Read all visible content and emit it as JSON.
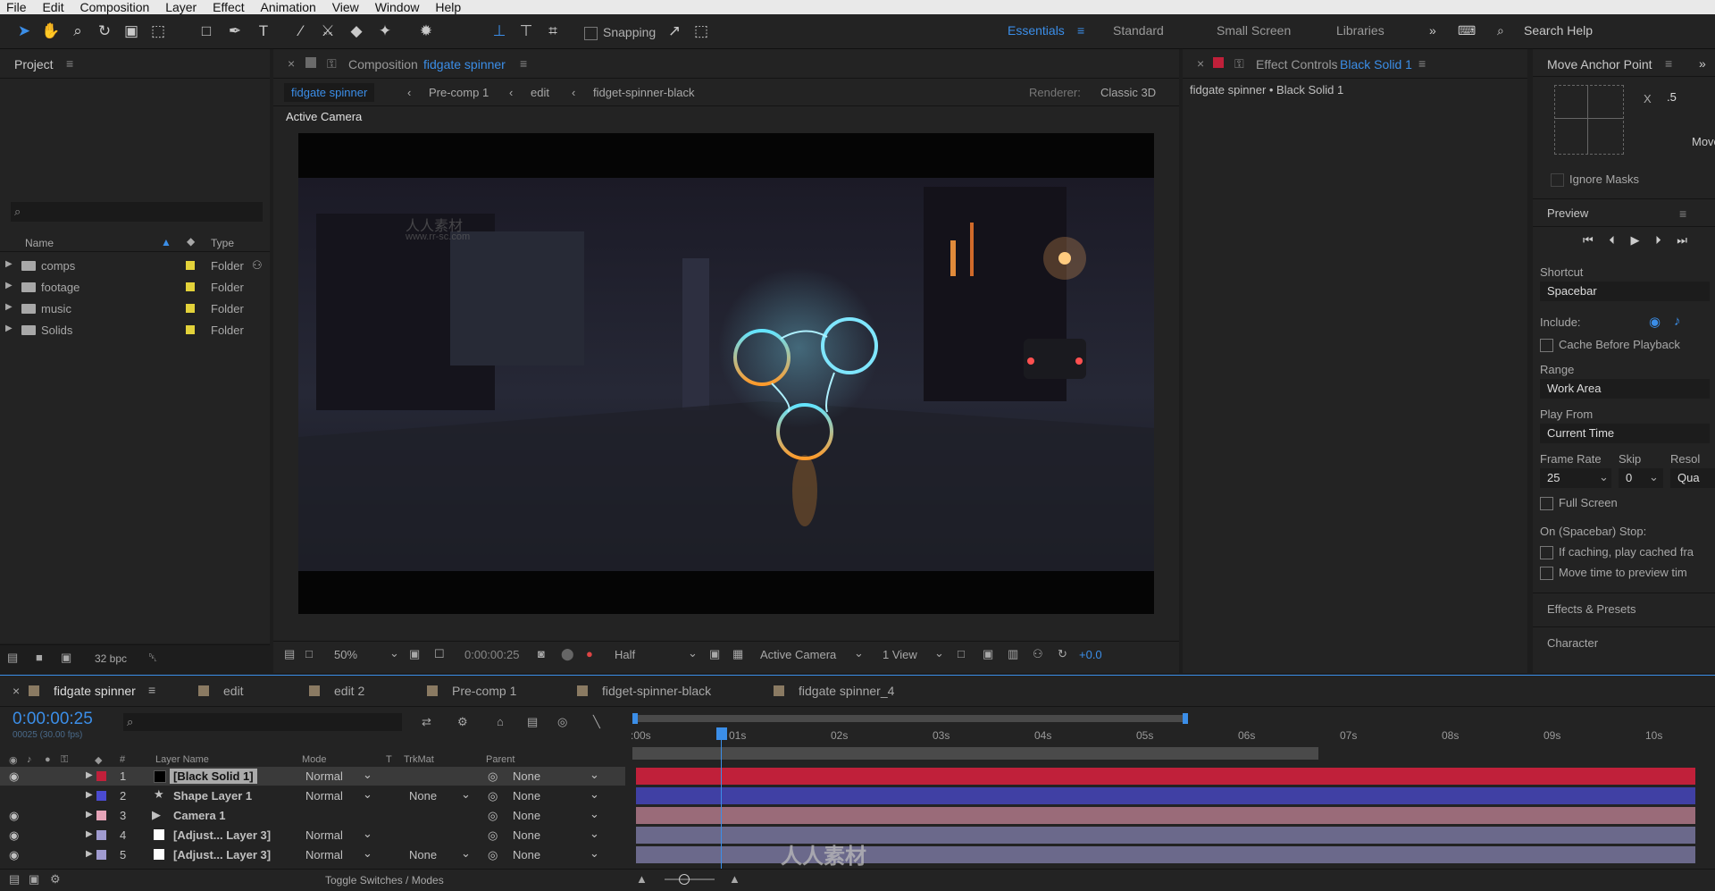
{
  "menubar": [
    "File",
    "Edit",
    "Composition",
    "Layer",
    "Effect",
    "Animation",
    "View",
    "Window",
    "Help"
  ],
  "toolbar": {
    "snapping": "Snapping",
    "workspaces": [
      "Essentials",
      "Standard",
      "Small Screen",
      "Libraries"
    ],
    "search_help": "Search Help"
  },
  "project": {
    "title": "Project",
    "bpc": "32 bpc",
    "columns": {
      "name": "Name",
      "type": "Type"
    },
    "items": [
      {
        "name": "comps",
        "type": "Folder"
      },
      {
        "name": "footage",
        "type": "Folder"
      },
      {
        "name": "music",
        "type": "Folder"
      },
      {
        "name": "Solids",
        "type": "Folder"
      }
    ]
  },
  "composition": {
    "tab_prefix": "Composition",
    "tab_name": "fidgate spinner",
    "breadcrumbs": [
      "fidgate spinner",
      "Pre-comp 1",
      "edit",
      "fidget-spinner-black"
    ],
    "renderer_label": "Renderer:",
    "renderer_value": "Classic 3D",
    "active_camera": "Active Camera",
    "zoom": "50%",
    "timecode": "0:00:00:25",
    "resolution": "Half",
    "camera_select": "Active Camera",
    "view": "1 View",
    "exposure": "+0.0"
  },
  "effect_controls": {
    "title_prefix": "Effect Controls",
    "title_layer": "Black Solid 1",
    "subtitle": "fidgate spinner • Black Solid 1"
  },
  "right_panel": {
    "anchor_title": "Move Anchor Point",
    "x_label": "X",
    "x_value": ".5",
    "move_label": "Move",
    "ignore_masks": "Ignore Masks",
    "preview_title": "Preview",
    "shortcut_label": "Shortcut",
    "shortcut_value": "Spacebar",
    "include_label": "Include:",
    "cache_before": "Cache Before Playback",
    "range_label": "Range",
    "range_value": "Work Area",
    "play_from_label": "Play From",
    "play_from_value": "Current Time",
    "frame_rate_label": "Frame Rate",
    "skip_label": "Skip",
    "resol_label": "Resol",
    "frame_rate_value": "25",
    "skip_value": "0",
    "resol_value": "Qua",
    "full_screen": "Full Screen",
    "on_stop_label": "On (Spacebar) Stop:",
    "if_caching": "If caching, play cached fra",
    "move_time": "Move time to preview tim",
    "effects_presets": "Effects & Presets",
    "character": "Character"
  },
  "timeline": {
    "tabs": [
      "fidgate spinner",
      "edit",
      "edit 2",
      "Pre-comp 1",
      "fidget-spinner-black",
      "fidgate spinner_4"
    ],
    "timecode": "0:00:00:25",
    "frame_info": "00025 (30.00 fps)",
    "columns": {
      "num": "#",
      "layer_name": "Layer Name",
      "mode": "Mode",
      "t": "T",
      "trkmat": "TrkMat",
      "parent": "Parent"
    },
    "layers": [
      {
        "num": "1",
        "name": "[Black Solid 1]",
        "mode": "Normal",
        "trkmat": "",
        "parent": "None",
        "color": "#c0203a"
      },
      {
        "num": "2",
        "name": "Shape Layer 1",
        "mode": "Normal",
        "trkmat": "None",
        "parent": "None",
        "color": "#4b4bd0"
      },
      {
        "num": "3",
        "name": "Camera 1",
        "mode": "",
        "trkmat": "",
        "parent": "None",
        "color": "#e6a4b8"
      },
      {
        "num": "4",
        "name": "[Adjust... Layer 3]",
        "mode": "Normal",
        "trkmat": "",
        "parent": "None",
        "color": "#a09bd0"
      },
      {
        "num": "5",
        "name": "[Adjust... Layer 3]",
        "mode": "Normal",
        "trkmat": "None",
        "parent": "None",
        "color": "#a09bd0"
      }
    ],
    "ruler": [
      ":00s",
      "01s",
      "02s",
      "03s",
      "04s",
      "05s",
      "06s",
      "07s",
      "08s",
      "09s",
      "10s"
    ],
    "toggle": "Toggle Switches / Modes"
  },
  "watermark": {
    "brand": "人人素材",
    "url": "www.rr-sc.com"
  }
}
